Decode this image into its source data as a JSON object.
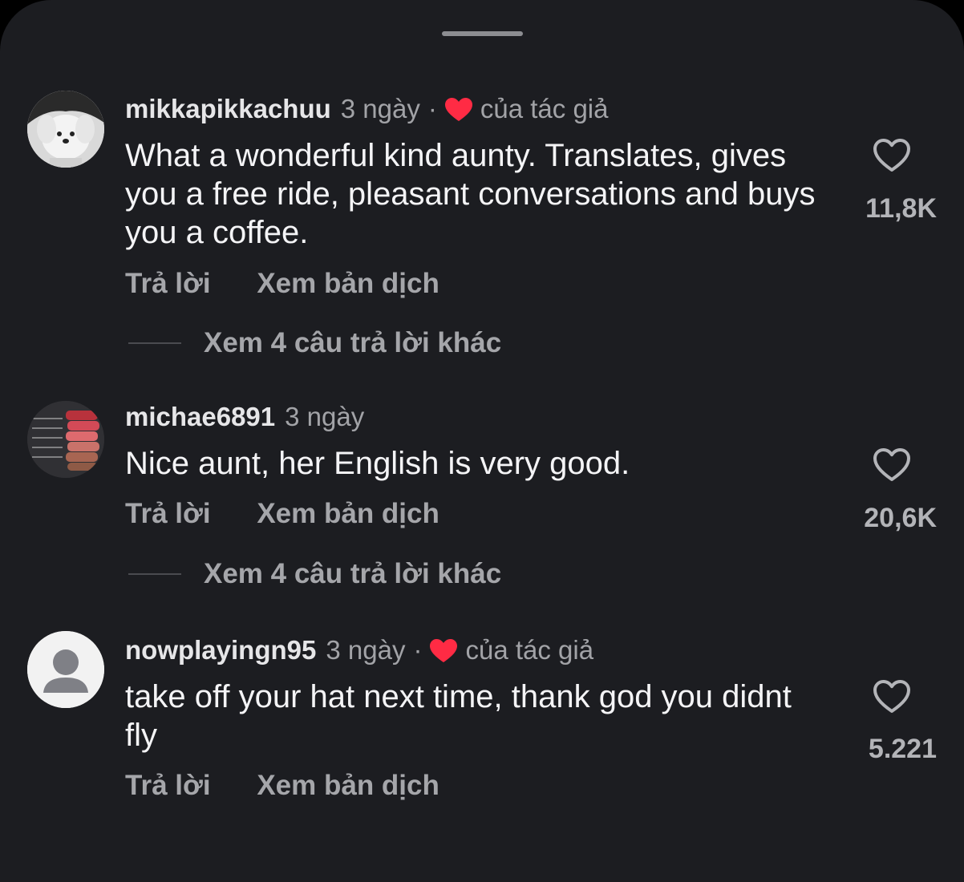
{
  "colors": {
    "background": "#1c1d21",
    "heart_red": "#ff2b44",
    "username": "#e6e6e8",
    "secondary": "#a2a3a7"
  },
  "comments": [
    {
      "username": "mikkapikkachuu",
      "time": "3 ngày",
      "separator": "·",
      "liked_by_author_label": "của tác giả",
      "text": "What a wonderful kind aunty. Translates, gives you a free ride, pleasant conversations and buys you a coffee.",
      "reply_label": "Trả lời",
      "translate_label": "Xem bản dịch",
      "view_replies_label": "Xem 4 câu trả lời khác",
      "like_count": "11,8K",
      "avatar_icon": "dog-avatar"
    },
    {
      "username": "michae6891",
      "time": "3 ngày",
      "text": "Nice aunt, her English is very good.",
      "reply_label": "Trả lời",
      "translate_label": "Xem bản dịch",
      "view_replies_label": "Xem 4 câu trả lời khác",
      "like_count": "20,6K",
      "avatar_icon": "steak-doneness-avatar"
    },
    {
      "username": "nowplayingn95",
      "time": "3 ngày",
      "separator": "·",
      "liked_by_author_label": "của tác giả",
      "text": "take off your hat next time, thank god you didnt fly",
      "reply_label": "Trả lời",
      "translate_label": "Xem bản dịch",
      "like_count": "5.221",
      "avatar_icon": "default-user-avatar"
    }
  ]
}
